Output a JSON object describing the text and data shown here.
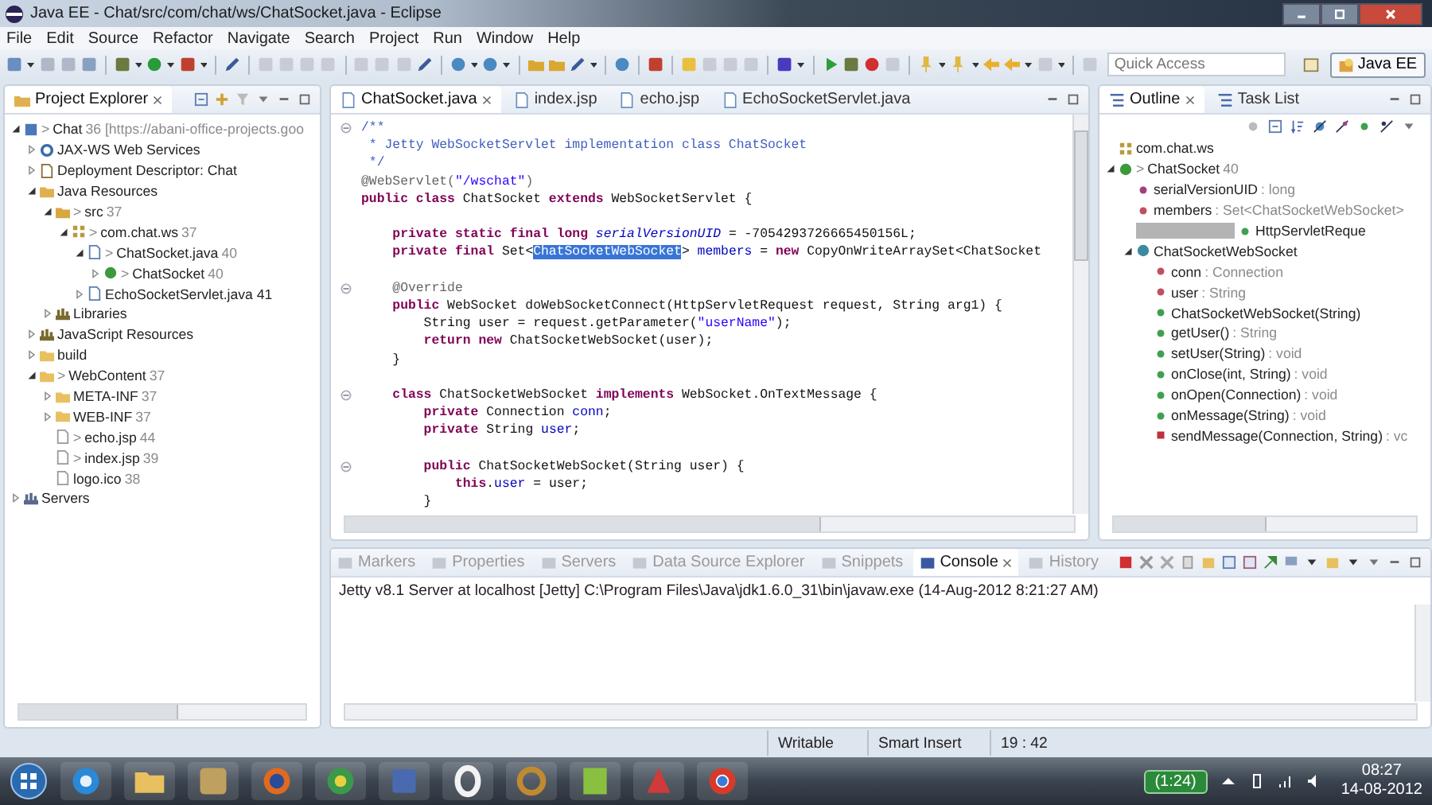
{
  "window": {
    "title": "Java EE - Chat/src/com/chat/ws/ChatSocket.java - Eclipse"
  },
  "menu": [
    "File",
    "Edit",
    "Source",
    "Refactor",
    "Navigate",
    "Search",
    "Project",
    "Run",
    "Window",
    "Help"
  ],
  "quick_access": {
    "placeholder": "Quick Access"
  },
  "perspective": {
    "label": "Java EE",
    "selected": true
  },
  "explorer": {
    "title": "Project Explorer",
    "items": [
      {
        "label": "Chat",
        "prefix": ">",
        "decoration": "36 [https://abani-office-projects.goo",
        "kind": "project",
        "expanded": true,
        "children": [
          {
            "label": "JAX-WS Web Services",
            "kind": "webservice",
            "expanded": false
          },
          {
            "label": "Deployment Descriptor: Chat",
            "kind": "descriptor",
            "expanded": false
          },
          {
            "label": "Java Resources",
            "kind": "resources",
            "expanded": true,
            "children": [
              {
                "label": "src",
                "prefix": ">",
                "decoration": "37",
                "kind": "srcfolder",
                "expanded": true,
                "children": [
                  {
                    "label": "com.chat.ws",
                    "prefix": ">",
                    "decoration": "37",
                    "kind": "package",
                    "expanded": true,
                    "children": [
                      {
                        "label": "ChatSocket.java",
                        "prefix": ">",
                        "decoration": "40",
                        "kind": "javafile",
                        "expanded": true,
                        "children": [
                          {
                            "label": "ChatSocket",
                            "prefix": ">",
                            "decoration": "40",
                            "kind": "class",
                            "expanded": false
                          }
                        ]
                      },
                      {
                        "label": "EchoSocketServlet.java 41",
                        "kind": "javafile",
                        "expanded": false
                      }
                    ]
                  }
                ]
              },
              {
                "label": "Libraries",
                "kind": "library",
                "expanded": false
              }
            ]
          },
          {
            "label": "JavaScript Resources",
            "kind": "library",
            "expanded": false
          },
          {
            "label": "build",
            "kind": "folder",
            "expanded": false
          },
          {
            "label": "WebContent",
            "prefix": ">",
            "decoration": "37",
            "kind": "webfolder",
            "expanded": true,
            "children": [
              {
                "label": "META-INF",
                "decoration": "37",
                "kind": "webfolder",
                "expanded": false
              },
              {
                "label": "WEB-INF",
                "decoration": "37",
                "kind": "webfolder",
                "expanded": false
              },
              {
                "label": "echo.jsp",
                "prefix": ">",
                "decoration": "44",
                "kind": "file"
              },
              {
                "label": "index.jsp",
                "prefix": ">",
                "decoration": "39",
                "kind": "file"
              },
              {
                "label": "logo.ico",
                "decoration": "38",
                "kind": "file"
              }
            ]
          }
        ]
      },
      {
        "label": "Servers",
        "kind": "servers",
        "expanded": false
      }
    ]
  },
  "editor": {
    "tabs": [
      {
        "label": "ChatSocket.java",
        "selected": true
      },
      {
        "label": "index.jsp",
        "selected": false
      },
      {
        "label": "echo.jsp",
        "selected": false
      },
      {
        "label": "EchoSocketServlet.java",
        "selected": false
      }
    ],
    "lines": [
      {
        "fold": true,
        "gap_before": false,
        "tokens": [
          {
            "kind": "comment",
            "text": "/**"
          }
        ]
      },
      {
        "fold": false,
        "gap_before": false,
        "tokens": [
          {
            "kind": "comment",
            "text": " * Jetty WebSocketServlet implementation class ChatSocket"
          }
        ]
      },
      {
        "fold": false,
        "gap_before": false,
        "tokens": [
          {
            "kind": "comment",
            "text": " */"
          }
        ]
      },
      {
        "fold": false,
        "gap_before": false,
        "tokens": [
          {
            "kind": "annotation",
            "text": "@WebServlet("
          },
          {
            "kind": "string",
            "text": "\"/wschat\""
          },
          {
            "kind": "annotation",
            "text": ")"
          }
        ]
      },
      {
        "fold": false,
        "gap_before": false,
        "tokens": [
          {
            "kind": "keyword",
            "text": "public class "
          },
          {
            "kind": "plain",
            "text": "ChatSocket "
          },
          {
            "kind": "keyword",
            "text": "extends "
          },
          {
            "kind": "plain",
            "text": "WebSocketServlet {"
          }
        ]
      },
      {
        "fold": false,
        "gap_before": true,
        "tokens": [
          {
            "kind": "keyword",
            "text": "    private static final long "
          },
          {
            "kind": "static",
            "text": "serialVersionUID"
          },
          {
            "kind": "plain",
            "text": " = -7054293726665450156L;"
          }
        ]
      },
      {
        "fold": false,
        "gap_before": false,
        "tokens": [
          {
            "kind": "keyword",
            "text": "    private final "
          },
          {
            "kind": "plain",
            "text": "Set<"
          },
          {
            "kind": "selection",
            "text": "ChatSocketWebSocket"
          },
          {
            "kind": "plain",
            "text": "> "
          },
          {
            "kind": "field",
            "text": "members"
          },
          {
            "kind": "plain",
            "text": " = "
          },
          {
            "kind": "keyword",
            "text": "new "
          },
          {
            "kind": "plain",
            "text": "CopyOnWriteArraySet<ChatSocket"
          }
        ]
      },
      {
        "fold": true,
        "gap_before": true,
        "tokens": [
          {
            "kind": "annotation",
            "text": "    @Override"
          }
        ]
      },
      {
        "fold": false,
        "gap_before": false,
        "tokens": [
          {
            "kind": "keyword",
            "text": "    public "
          },
          {
            "kind": "plain",
            "text": "WebSocket doWebSocketConnect(HttpServletRequest request, String arg1) {"
          }
        ]
      },
      {
        "fold": false,
        "gap_before": false,
        "tokens": [
          {
            "kind": "plain",
            "text": "        String user = request.getParameter("
          },
          {
            "kind": "string",
            "text": "\"userName\""
          },
          {
            "kind": "plain",
            "text": ");"
          }
        ]
      },
      {
        "fold": false,
        "gap_before": false,
        "tokens": [
          {
            "kind": "keyword",
            "text": "        return new "
          },
          {
            "kind": "plain",
            "text": "ChatSocketWebSocket(user);"
          }
        ]
      },
      {
        "fold": false,
        "gap_before": false,
        "tokens": [
          {
            "kind": "plain",
            "text": "    }"
          }
        ]
      },
      {
        "fold": true,
        "gap_before": true,
        "tokens": [
          {
            "kind": "keyword",
            "text": "    class "
          },
          {
            "kind": "plain",
            "text": "ChatSocketWebSocket "
          },
          {
            "kind": "keyword",
            "text": "implements "
          },
          {
            "kind": "plain",
            "text": "WebSocket.OnTextMessage {"
          }
        ]
      },
      {
        "fold": false,
        "gap_before": false,
        "tokens": [
          {
            "kind": "keyword",
            "text": "        private "
          },
          {
            "kind": "plain",
            "text": "Connection "
          },
          {
            "kind": "field",
            "text": "conn"
          },
          {
            "kind": "plain",
            "text": ";"
          }
        ]
      },
      {
        "fold": false,
        "gap_before": false,
        "tokens": [
          {
            "kind": "keyword",
            "text": "        private "
          },
          {
            "kind": "plain",
            "text": "String "
          },
          {
            "kind": "field",
            "text": "user"
          },
          {
            "kind": "plain",
            "text": ";"
          }
        ]
      },
      {
        "fold": true,
        "gap_before": true,
        "tokens": [
          {
            "kind": "keyword",
            "text": "        public "
          },
          {
            "kind": "plain",
            "text": "ChatSocketWebSocket(String user) {"
          }
        ]
      },
      {
        "fold": false,
        "gap_before": false,
        "tokens": [
          {
            "kind": "keyword",
            "text": "            this"
          },
          {
            "kind": "plain",
            "text": "."
          },
          {
            "kind": "field",
            "text": "user"
          },
          {
            "kind": "plain",
            "text": " = user;"
          }
        ]
      },
      {
        "fold": false,
        "gap_before": false,
        "tokens": [
          {
            "kind": "plain",
            "text": "        }"
          }
        ]
      }
    ]
  },
  "outline": {
    "tabs": [
      {
        "label": "Outline",
        "selected": true
      },
      {
        "label": "Task List",
        "selected": false
      }
    ],
    "items": [
      {
        "label": "com.chat.ws",
        "kind": "package"
      },
      {
        "label": "ChatSocket",
        "prefix": ">",
        "decoration": "40",
        "kind": "class",
        "expanded": true,
        "children": [
          {
            "label": "serialVersionUID",
            "type": ": long",
            "kind": "constant"
          },
          {
            "label": "members",
            "type": ": Set<ChatSocketWebSocket>",
            "kind": "privatefield"
          },
          {
            "label": "HttpServletReque",
            "kind": "method",
            "redacted": true
          },
          {
            "label": "ChatSocketWebSocket",
            "kind": "innerclass",
            "expanded": true,
            "children": [
              {
                "label": "conn",
                "type": ": Connection",
                "kind": "privatefield"
              },
              {
                "label": "user",
                "type": ": String",
                "kind": "privatefield"
              },
              {
                "label": "ChatSocketWebSocket(String)",
                "kind": "method"
              },
              {
                "label": "getUser()",
                "type": ": String",
                "kind": "method"
              },
              {
                "label": "setUser(String)",
                "type": ": void",
                "kind": "method"
              },
              {
                "label": "onClose(int, String)",
                "type": ": void",
                "kind": "method"
              },
              {
                "label": "onOpen(Connection)",
                "type": ": void",
                "kind": "method"
              },
              {
                "label": "onMessage(String)",
                "type": ": void",
                "kind": "method"
              },
              {
                "label": "sendMessage(Connection, String)",
                "type": ": vc",
                "kind": "privatemethod"
              }
            ]
          }
        ]
      }
    ]
  },
  "bottom": {
    "tabs": [
      {
        "label": "Markers",
        "selected": false
      },
      {
        "label": "Properties",
        "selected": false
      },
      {
        "label": "Servers",
        "selected": false
      },
      {
        "label": "Data Source Explorer",
        "selected": false
      },
      {
        "label": "Snippets",
        "selected": false
      },
      {
        "label": "Console",
        "selected": true
      },
      {
        "label": "History",
        "selected": false
      }
    ],
    "console_header": "Jetty v8.1 Server at localhost [Jetty] C:\\Program Files\\Java\\jdk1.6.0_31\\bin\\javaw.exe (14-Aug-2012 8:21:27 AM)"
  },
  "status_bar": [
    "Writable",
    "Smart Insert",
    "19 : 42"
  ],
  "taskbar": {
    "battery": "(1:24)",
    "time": "08:27",
    "date": "14-08-2012"
  }
}
